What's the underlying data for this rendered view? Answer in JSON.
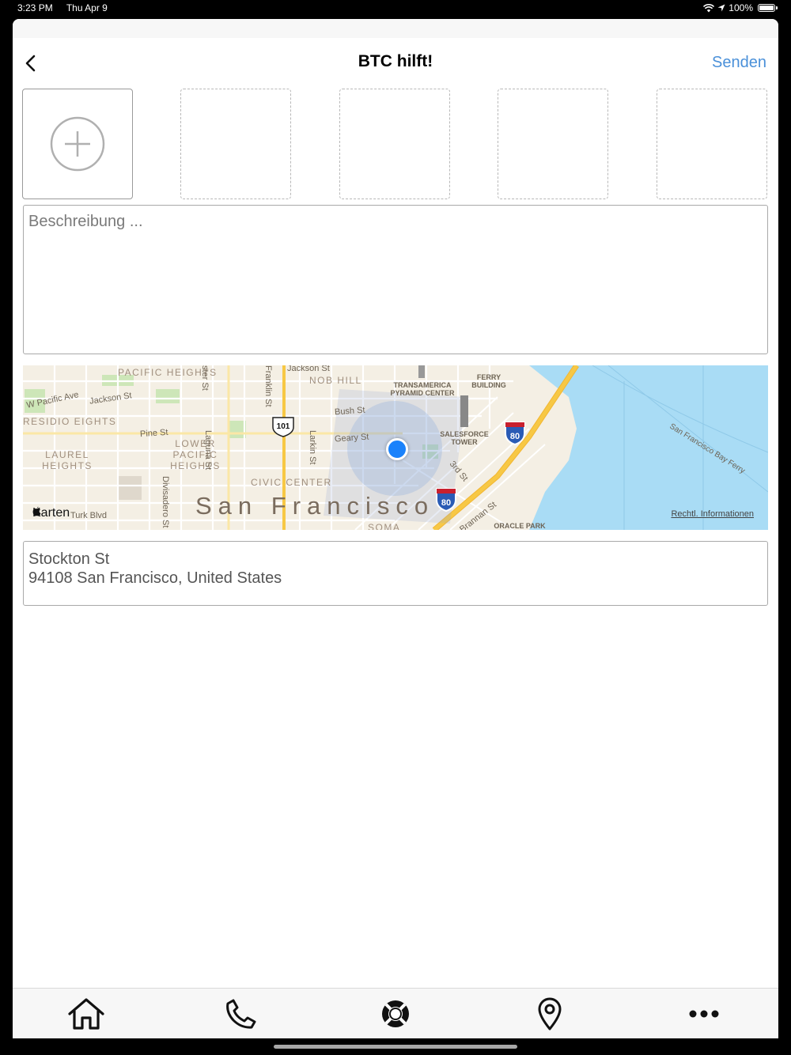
{
  "status": {
    "time": "3:23 PM",
    "date": "Thu Apr 9",
    "battery": "100%",
    "battery_level": 1.0
  },
  "nav": {
    "back_icon": "chevron-left-icon",
    "title": "BTC hilft!",
    "send_label": "Senden"
  },
  "photos": {
    "add_icon": "plus-circle-icon",
    "empty_slots": 4
  },
  "description": {
    "placeholder": "Beschreibung ...",
    "value": ""
  },
  "map": {
    "city": "San Francisco",
    "neighborhoods": [
      "PACIFIC HEIGHTS",
      "NOB HILL",
      "RESIDIO EIGHTS",
      "LOWER PACIFIC HEIGHTS",
      "LAUREL HEIGHTS",
      "CIVIC CENTER"
    ],
    "streets": [
      "W Pacific Ave",
      "Jackson St",
      "Jackson St",
      "Bush St",
      "Pine St",
      "Geary St",
      "Laguna St",
      "Larkin St",
      "Franklin St",
      "Divisadero St",
      "3rd St",
      "Brannan St",
      "ster St",
      "Turk Blvd",
      "San Francisco Bay Ferry",
      "SOMA"
    ],
    "pois": [
      "TRANSAMERICA PYRAMID CENTER",
      "FERRY BUILDING",
      "SALESFORCE TOWER",
      "ORACLE PARK"
    ],
    "shields": [
      "101",
      "80",
      "80"
    ],
    "attribution": "Karten",
    "legal": "Rechtl. Informationen",
    "colors": {
      "water": "#a9dcf5",
      "land": "#f4efe4",
      "highway": "#f7c845",
      "park": "#cde6b8",
      "location": "#1a82fb"
    }
  },
  "address": {
    "line1": "Stockton St",
    "line2": "94108 San Francisco, United States"
  },
  "tabs": [
    {
      "icon": "home-icon"
    },
    {
      "icon": "phone-icon"
    },
    {
      "icon": "lifebuoy-icon"
    },
    {
      "icon": "map-pin-icon"
    },
    {
      "icon": "more-icon"
    }
  ]
}
